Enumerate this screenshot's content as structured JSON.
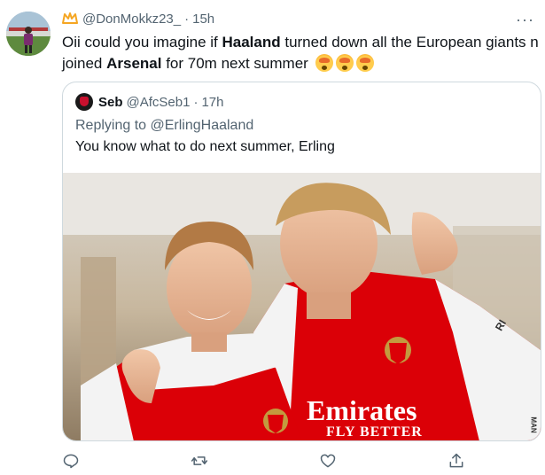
{
  "tweet": {
    "display_name": "",
    "handle": "@DonMokkz23_",
    "separator": "·",
    "time": "15h",
    "more_label": "···",
    "text_parts": [
      {
        "text": "Oii could you imagine if ",
        "bold": false
      },
      {
        "text": "Haaland",
        "bold": true
      },
      {
        "text": " turned down all the European giants n joined ",
        "bold": false
      },
      {
        "text": "Arsenal",
        "bold": true
      },
      {
        "text": " for 70m next summer",
        "bold": false
      }
    ],
    "emoji_count": 3,
    "emoji_name": "exploding-head-emoji"
  },
  "quote": {
    "name": "Seb",
    "handle": "@AfcSeb1",
    "separator": "·",
    "time": "17h",
    "replying_prefix": "Replying to ",
    "replying_to": "@ErlingHaaland",
    "text": "You know what to do next summer, Erling",
    "photo": {
      "shirt_sponsor": "Emirates",
      "shirt_sponsor_line2": "FLY BETTER",
      "side_text": "RI",
      "corner_text": "MAN"
    }
  },
  "actions": [
    {
      "name": "reply-icon"
    },
    {
      "name": "retweet-icon"
    },
    {
      "name": "like-icon"
    },
    {
      "name": "share-icon"
    }
  ],
  "colors": {
    "text_primary": "#0f1419",
    "text_secondary": "#536471",
    "border": "#cfd9de",
    "arsenal_red": "#db0007"
  }
}
